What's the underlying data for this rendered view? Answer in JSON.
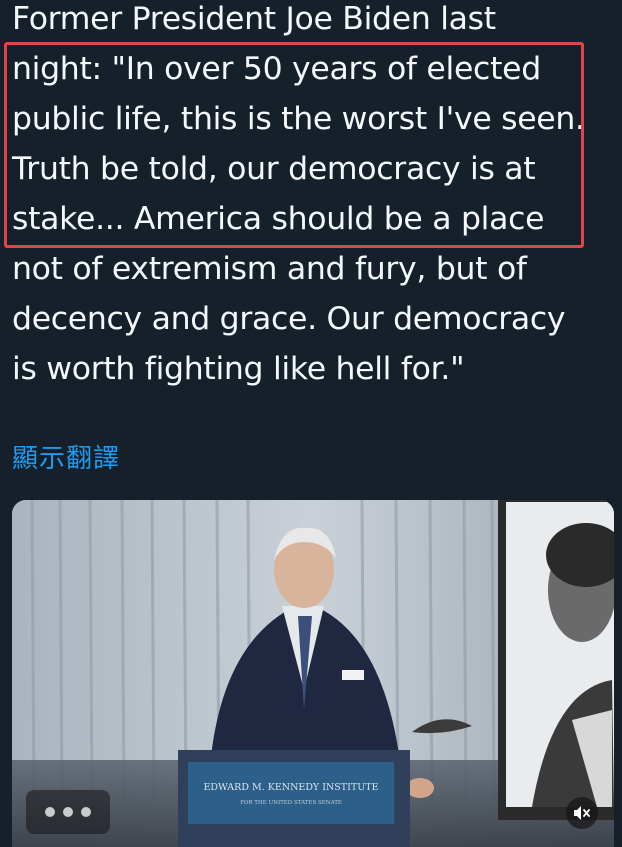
{
  "tweet": {
    "lines": [
      "Former President Joe Biden last",
      "night: \"In over 50 years of elected",
      "public life, this is the worst I've seen.",
      "Truth be told, our democracy is at",
      "stake... America should be a place",
      "not of extremism and fury, but of",
      "decency and grace. Our democracy",
      "is worth fighting like hell for.\""
    ],
    "translate_label": "顯示翻譯"
  },
  "media": {
    "podium_sign_line1": "EDWARD M. KENNEDY INSTITUTE",
    "podium_sign_line2": "FOR THE UNITED STATES SENATE",
    "mute_icon": "speaker-muted-icon",
    "gif_icon": "gif-dots-icon"
  },
  "colors": {
    "background": "#15202b",
    "text": "#f5f8fa",
    "link": "#1d9bf0",
    "highlight": "#e0454a"
  }
}
